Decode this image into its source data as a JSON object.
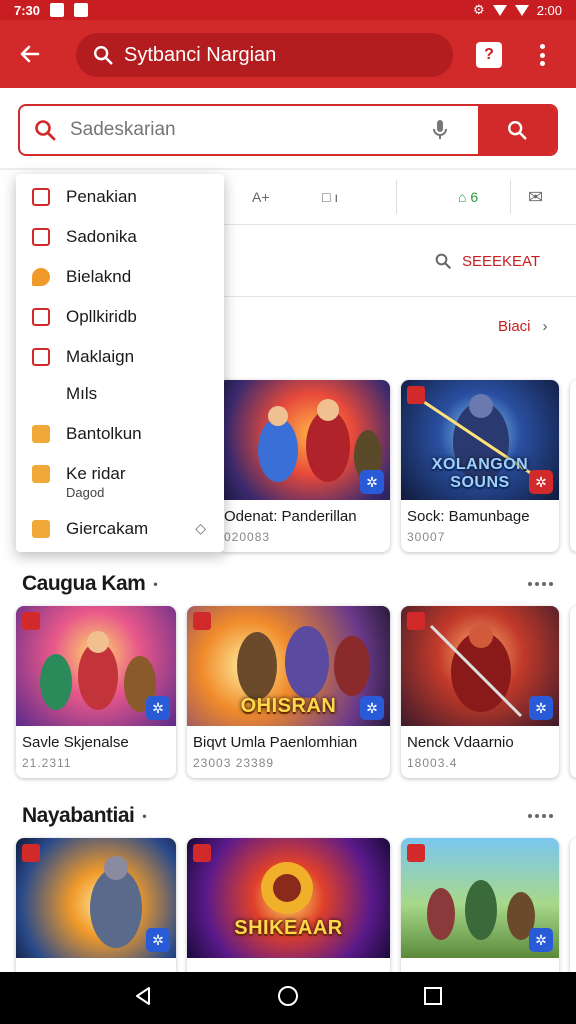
{
  "status_bar": {
    "time": "7:30",
    "battery": "2:00"
  },
  "app_bar": {
    "title": "Sytbanci Nargian",
    "help_label": "?"
  },
  "search": {
    "placeholder": "Sadeskarian"
  },
  "toolbar": {
    "tools": [
      "A+",
      "□ ı",
      "⌂ 6",
      "✉"
    ]
  },
  "links": {
    "see_all": "SEEEKEAT",
    "more": "Bіaci"
  },
  "menu": {
    "items": [
      {
        "label": "Penakian",
        "icon": "outline"
      },
      {
        "label": "Sadonika",
        "icon": "outline"
      },
      {
        "label": "Bielaknd",
        "icon": "orange"
      },
      {
        "label": "Opllkiridb",
        "icon": "outline"
      },
      {
        "label": "Maklaign",
        "icon": "outline"
      },
      {
        "label": "Mıls",
        "icon": "none"
      },
      {
        "label": "Bantolkun",
        "icon": "amber"
      },
      {
        "label": "Ke ridar",
        "sub": "Dagod",
        "icon": "amber"
      },
      {
        "label": "Giercakam",
        "icon": "amber",
        "chevron": true
      }
    ]
  },
  "row1": {
    "cards": [
      {
        "name": "Odenat: Panderillan",
        "meta": "020083"
      },
      {
        "name": "Sock: Bamunbage",
        "meta": "30007",
        "overlay": "XOLANGON SOUNS"
      }
    ]
  },
  "section2": {
    "title": "Caugua Kam",
    "cards": [
      {
        "name": "Savle Skjenalse",
        "meta": "21.2311"
      },
      {
        "name": "Biqvt Umla Paenlomhian",
        "meta": "23003 23389",
        "overlay": "OHISRAN"
      },
      {
        "name": "Nenck Vdaarnio",
        "meta": "18003.4"
      }
    ]
  },
  "section3": {
    "title": "Nayabantiai",
    "cards": [
      {
        "name": "",
        "meta": ""
      },
      {
        "name": "",
        "meta": "",
        "overlay": "SHIKEAAR"
      },
      {
        "name": "",
        "meta": ""
      }
    ]
  }
}
